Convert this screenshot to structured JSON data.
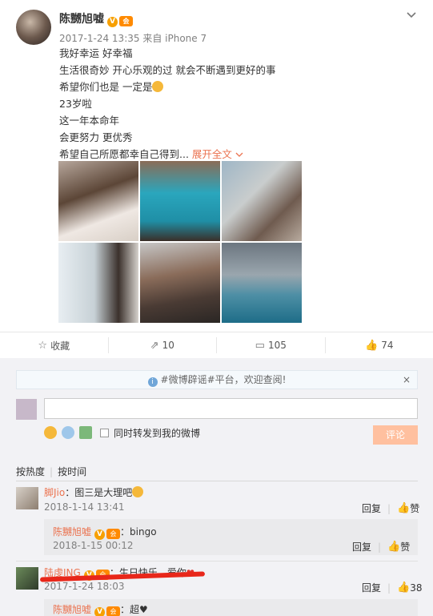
{
  "post": {
    "author": "陈嬲旭嘘",
    "time": "2017-1-24 13:35",
    "source": "来自 iPhone 7",
    "lines": [
      "我好幸运 好幸福",
      "生活很奇妙 开心乐观的过 就会不断遇到更好的事",
      "希望你们也是 一定是",
      "23岁啦",
      "这一年本命年",
      "会更努力 更优秀",
      "希望自己所愿都幸自己得到..."
    ],
    "expand_label": "展开全文",
    "badge_v": "V",
    "badge_lv": "会"
  },
  "actions": {
    "fav": "收藏",
    "forward_count": "10",
    "comment_count": "105",
    "like_count": "74"
  },
  "notice": {
    "text": "#微博辟谣#平台，欢迎查阅!",
    "close": "×"
  },
  "composer": {
    "repost_label": "同时转发到我的微博",
    "submit_label": "评论"
  },
  "sort": {
    "hot": "按热度",
    "time": "按时间"
  },
  "comments": [
    {
      "name": "脚Jio",
      "text": "：图三是大理吧",
      "time": "2018-1-14 13:41",
      "reply_label": "回复",
      "like_label": "赞",
      "reply": {
        "name": "陈嬲旭嘘",
        "text": "：bingo",
        "time": "2018-1-15 00:12",
        "reply_label": "回复",
        "like_label": "赞"
      }
    },
    {
      "name": "陆虔ING",
      "text": "：生日快乐，爱你",
      "time": "2017-1-24 18:03",
      "reply_label": "回复",
      "like_label": "38",
      "reply": {
        "name": "陈嬲旭嘘",
        "text": "：超"
      }
    }
  ],
  "colors": {
    "accent": "#eb7350",
    "submit_bg": "#ffc09f",
    "badge_orange": "#f7a000",
    "red_underline": "#e8271a"
  }
}
